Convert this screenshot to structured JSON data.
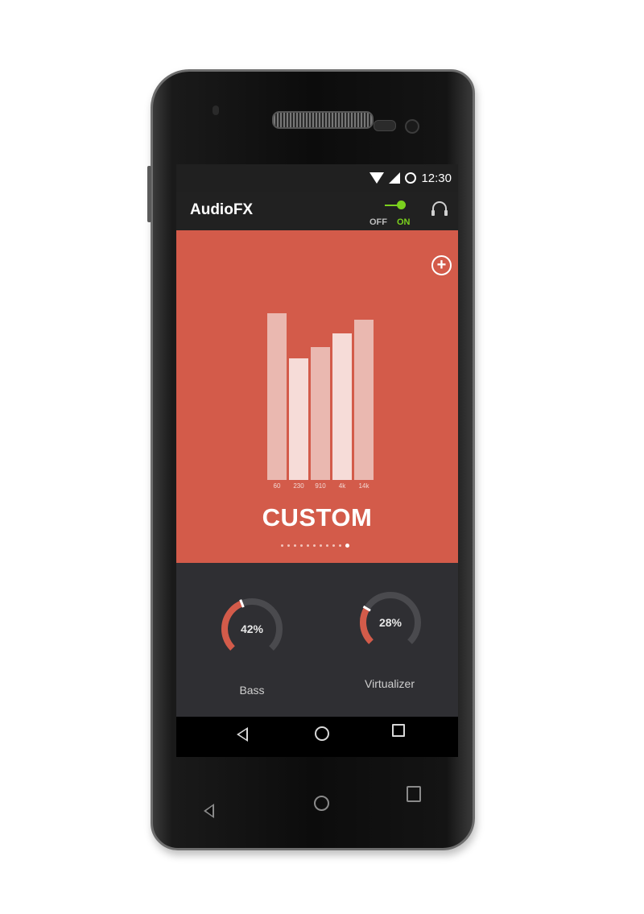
{
  "status_bar": {
    "time": "12:30"
  },
  "app_bar": {
    "title": "AudioFX",
    "toggle": {
      "off_label": "OFF",
      "on_label": "ON",
      "state": "on"
    },
    "headphones_icon": "headphones-icon"
  },
  "equalizer": {
    "add_icon": "plus-circle-icon",
    "preset_name": "CUSTOM",
    "bands": [
      {
        "label": "60",
        "level": 0.59
      },
      {
        "label": "230",
        "level": 0.43
      },
      {
        "label": "910",
        "level": 0.47
      },
      {
        "label": "4k",
        "level": 0.52
      },
      {
        "label": "14k",
        "level": 0.57
      }
    ],
    "page_count": 11,
    "active_page": 10
  },
  "effects": [
    {
      "label": "Bass",
      "value_text": "42%",
      "value": 0.42
    },
    {
      "label": "Virtualizer",
      "value_text": "28%",
      "value": 0.28
    }
  ],
  "colors": {
    "accent": "#d35b4a",
    "toggle_on": "#7bd11e",
    "knob_track": "#4a4a4e"
  }
}
